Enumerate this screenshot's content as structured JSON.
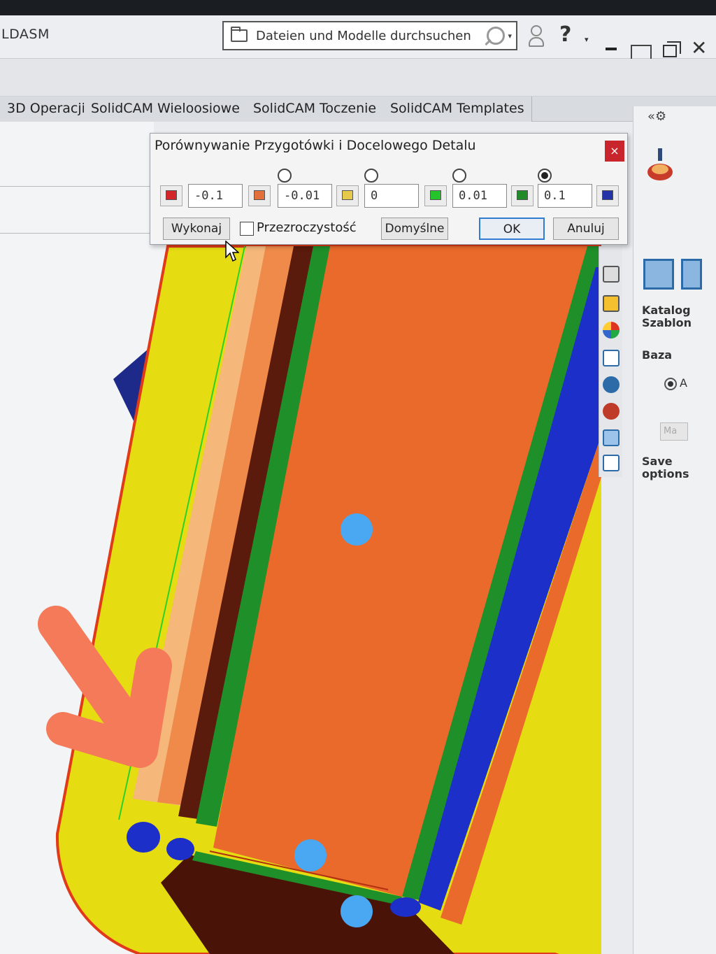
{
  "window": {
    "app_title": "LDASM",
    "search_text": "Dateien und Modelle durchsuchen",
    "help_label": "?",
    "close_label": "✕"
  },
  "tabs": [
    {
      "label": "3D Operacji"
    },
    {
      "label": "SolidCAM Wieloosiowe"
    },
    {
      "label": "SolidCAM Toczenie"
    },
    {
      "label": "SolidCAM Templates"
    }
  ],
  "dialog": {
    "title": "Porównywanie Przygotówki i Docelowego Detalu",
    "close_label": "×",
    "tolerances": [
      "-0.1",
      "-0.01",
      "0",
      "0.01",
      "0.1"
    ],
    "selected_radio_index": 3,
    "colors": [
      "#d3262a",
      "#e3703a",
      "#e6c84a",
      "#25c42c",
      "#238a2a",
      "#2533a8"
    ],
    "execute_label": "Wykonaj",
    "transparency_label": "Przezroczystość",
    "transparency_checked": false,
    "default_label": "Domyślne",
    "ok_label": "OK",
    "cancel_label": "Anuluj"
  },
  "right_panel": {
    "header_glyphs": "«⚙",
    "catalog_label": "Katalog",
    "templates_label": "Szablon",
    "base_label": "Baza",
    "radio_suffix": "A",
    "button_label": "Ma",
    "save_label_1": "Save",
    "save_label_2": "options"
  },
  "colors": {
    "yellow_stock": "#e6dc12",
    "orange_part": "#e96a2a",
    "green_edge": "#1f8f2a",
    "blue_edge": "#1c2fc8",
    "dark_red": "#5a1a0c",
    "marker": "#4aa7f2",
    "annotation": "#f47a5a"
  }
}
